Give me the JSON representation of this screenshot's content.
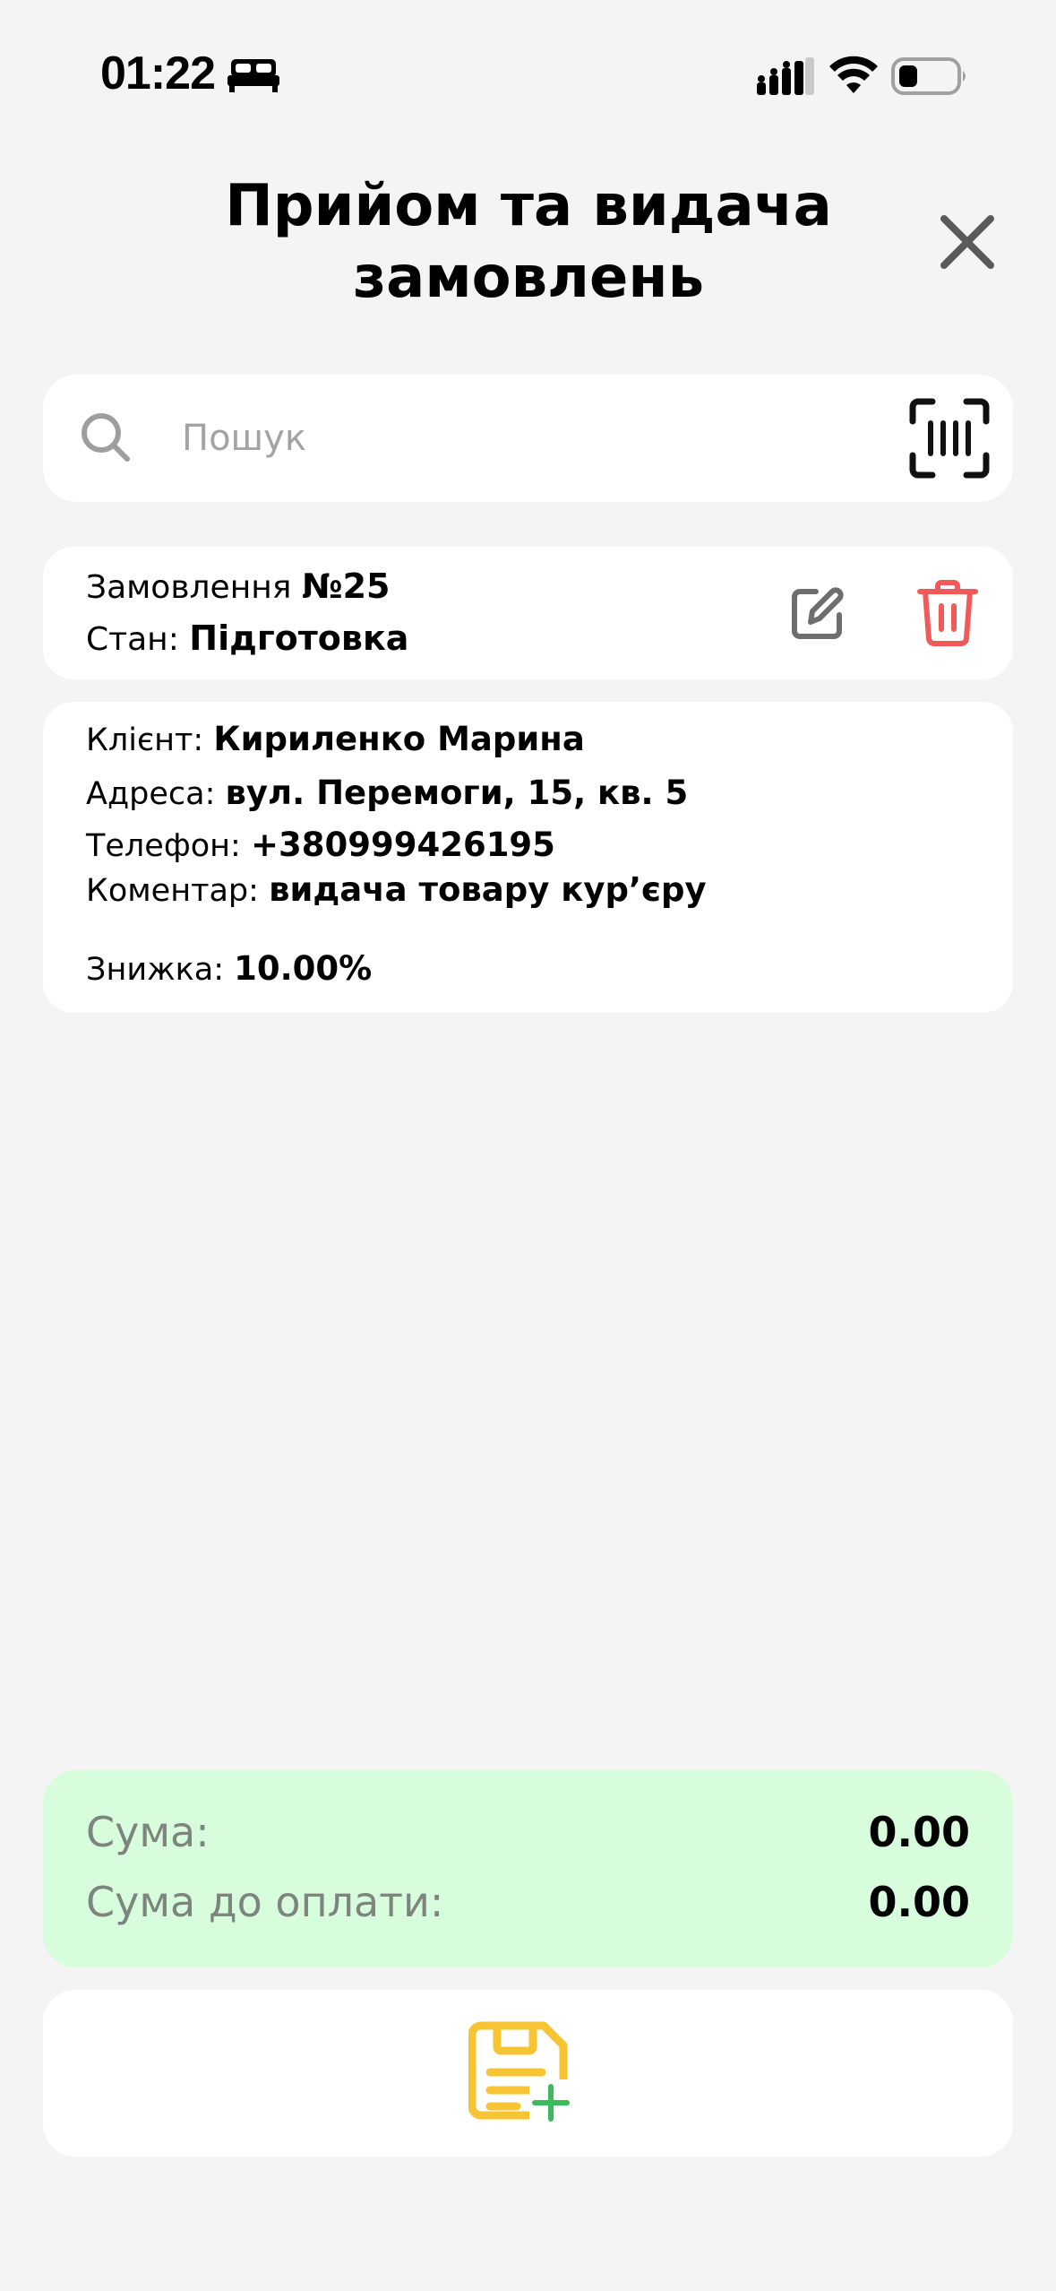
{
  "status_bar": {
    "time": "01:22",
    "icons": [
      "bed-icon",
      "signal-icon",
      "wifi-icon",
      "battery-icon"
    ]
  },
  "header": {
    "title": "Прийом та видача\nзамовлень",
    "close_icon": "close-icon"
  },
  "search": {
    "placeholder": "Пошук",
    "value": "",
    "left_icon": "search-icon",
    "right_icon": "barcode-scan-icon"
  },
  "order": {
    "number_label": "Замовлення",
    "number_value": "№25",
    "state_label": "Стан:",
    "state_value": "Підготовка",
    "actions": [
      "edit-icon",
      "delete-icon"
    ]
  },
  "details": {
    "client_label": "Клієнт:",
    "client_value": "Кириленко Марина",
    "address_label": "Адреса:",
    "address_value": "вул. Перемоги, 15, кв. 5",
    "phone_label": "Телефон:",
    "phone_value": "+380999426195",
    "comment_label": "Коментар:",
    "comment_value": "видача товару кур’єру",
    "discount_label": "Знижка:",
    "discount_value": "10.00%"
  },
  "totals": {
    "sum_label": "Сума:",
    "sum_value": "0.00",
    "due_label": "Сума до оплати:",
    "due_value": "0.00"
  },
  "action": {
    "icon": "add-document-icon"
  },
  "colors": {
    "background": "#f4f4f4",
    "card": "#ffffff",
    "sum_background": "#d8fddc",
    "delete_red": "#f05a5a",
    "doc_yellow": "#f7c534",
    "plus_green": "#3dbb5c",
    "icon_gray": "#6e6e6e"
  }
}
